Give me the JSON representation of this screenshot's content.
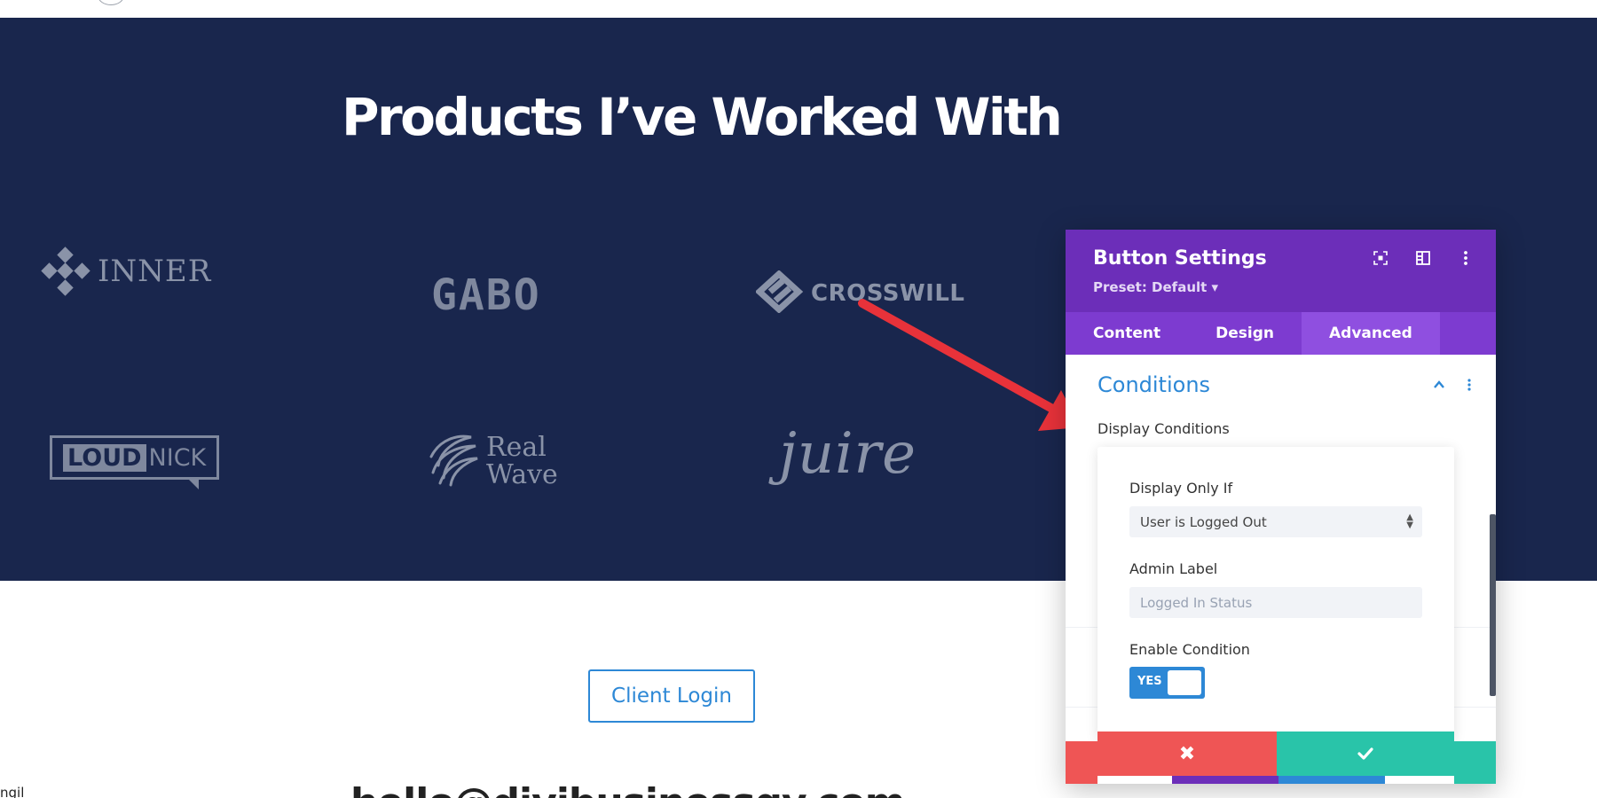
{
  "hero": {
    "title": "Products I’ve Worked With"
  },
  "logos": {
    "inner": "INNER",
    "gabo": "GABO",
    "crosswill": "CROSSWILL",
    "loudnick_loud": "LOUD",
    "loudnick_nick": "NICK",
    "realwave_line1": "Real",
    "realwave_line2": "Wave",
    "juire": "juire"
  },
  "page": {
    "client_login": "Client Login",
    "email_partial": "hello@divibusinessgy.com",
    "side_text": "ngil"
  },
  "modal": {
    "title": "Button Settings",
    "preset": "Preset: Default ▾",
    "tabs": [
      {
        "label": "Content",
        "active": false
      },
      {
        "label": "Design",
        "active": false
      },
      {
        "label": "Advanced",
        "active": true
      }
    ],
    "section_title": "Conditions",
    "display_conditions_label": "Display Conditions",
    "condition": {
      "display_only_if_label": "Display Only If",
      "display_only_if_value": "User is Logged Out",
      "admin_label_label": "Admin Label",
      "admin_label_placeholder": "Logged In Status",
      "enable_condition_label": "Enable Condition",
      "toggle_value": "YES"
    },
    "cancel_glyph": "✖"
  },
  "colors": {
    "hero_bg": "#19264d",
    "modal_header": "#6c2eb9",
    "tabs_bg": "#7d3bd0",
    "accent_blue": "#2d88d6",
    "cancel_red": "#ef5555",
    "save_green": "#29c4a9",
    "arrow_red": "#e8323a"
  }
}
